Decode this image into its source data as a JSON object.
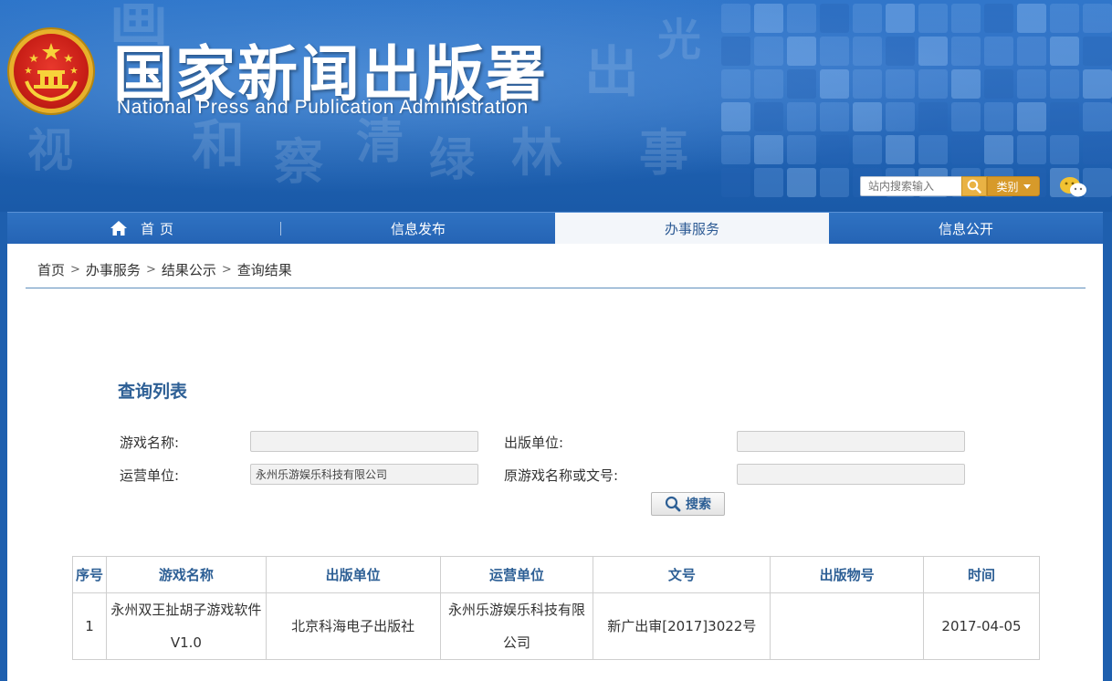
{
  "header": {
    "title": "国家新闻出版署",
    "subtitle": "National  Press and Publication Administration",
    "search_placeholder": "站内搜索输入",
    "category_label": "类别"
  },
  "nav": {
    "items": [
      {
        "label": "首页"
      },
      {
        "label": "信息发布"
      },
      {
        "label": "办事服务"
      },
      {
        "label": "信息公开"
      }
    ],
    "active_index": 2
  },
  "breadcrumb": {
    "items": [
      "首页",
      "办事服务",
      "结果公示",
      "查询结果"
    ],
    "separator": ">"
  },
  "query": {
    "title": "查询列表",
    "game_name_label": "游戏名称:",
    "game_name_value": "",
    "publisher_label": "出版单位:",
    "publisher_value": "",
    "operator_label": "运营单位:",
    "operator_value": "永州乐游娱乐科技有限公司",
    "original_label": "原游戏名称或文号:",
    "original_value": "",
    "search_button": "搜索"
  },
  "table": {
    "headers": [
      "序号",
      "游戏名称",
      "出版单位",
      "运营单位",
      "文号",
      "出版物号",
      "时间"
    ],
    "rows": [
      [
        "1",
        "永州双王扯胡子游戏软件V1.0",
        "北京科海电子出版社",
        "永州乐游娱乐科技有限公司",
        "新广出审[2017]3022号",
        "",
        "2017-04-05"
      ]
    ]
  },
  "colors": {
    "header_blue": "#1f62b4",
    "nav_blue": "#2564b5",
    "title_blue": "#2d5f95",
    "search_gold": "#e9b244",
    "emblem_red": "#c91f17"
  }
}
